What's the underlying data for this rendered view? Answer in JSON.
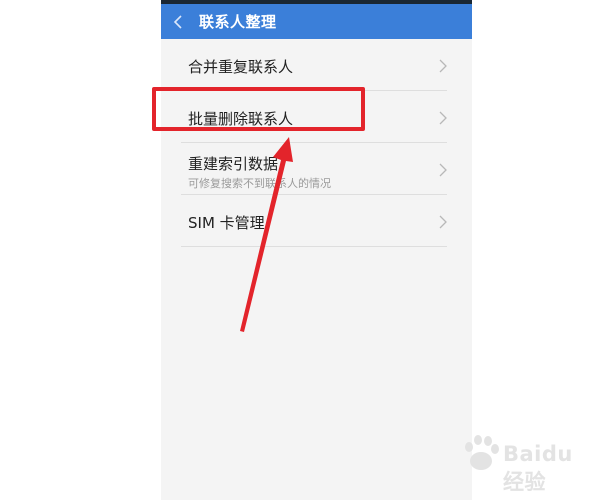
{
  "header": {
    "title": "联系人整理"
  },
  "menu": {
    "items": [
      {
        "title": "合并重复联系人"
      },
      {
        "title": "批量删除联系人"
      },
      {
        "title": "重建索引数据",
        "subtitle": "可修复搜索不到联系人的情况"
      },
      {
        "title": "SIM 卡管理"
      }
    ]
  },
  "annotation": {
    "highlighted_item": "批量删除联系人",
    "color": "#e3242b"
  },
  "watermark": {
    "text": "Baidu 经验"
  },
  "colors": {
    "header_bg": "#3b7fd9",
    "page_bg": "#f4f4f4",
    "accent_red": "#e3242b"
  },
  "icons": {
    "back": "chevron-left-icon",
    "row": "chevron-right-icon"
  }
}
